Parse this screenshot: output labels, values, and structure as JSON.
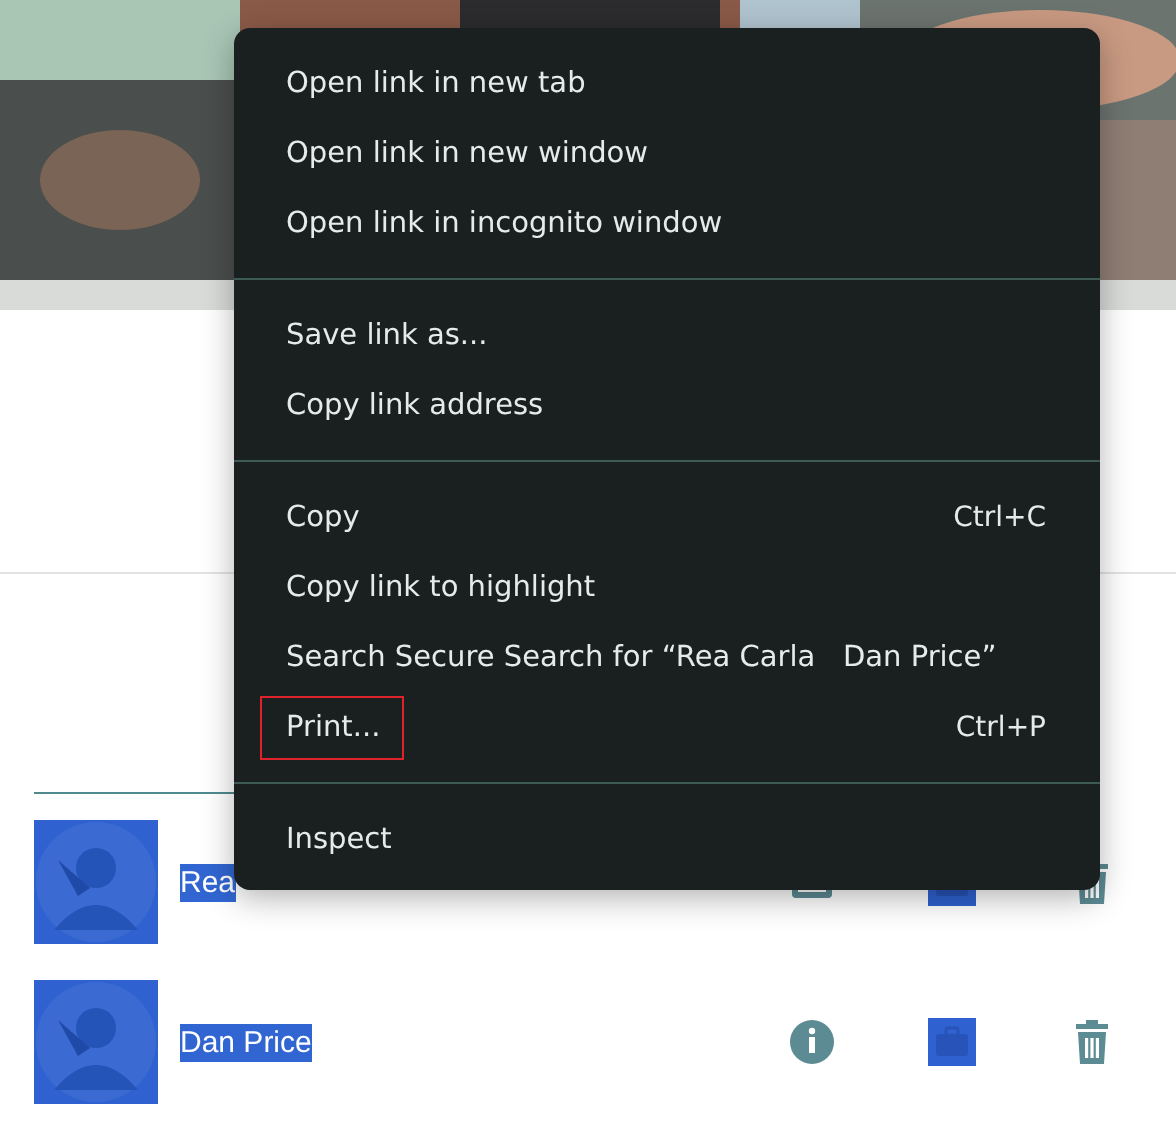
{
  "people": [
    {
      "name": "Rea",
      "selected": true
    },
    {
      "name": "Dan Price",
      "selected": true
    }
  ],
  "context_menu": {
    "sections": [
      [
        {
          "label": "Open link in new tab",
          "focused": false
        },
        {
          "label": "Open link in new window",
          "focused": false
        },
        {
          "label": "Open link in incognito window",
          "focused": false
        }
      ],
      [
        {
          "label": "Save link as...",
          "focused": false
        },
        {
          "label": "Copy link address",
          "focused": false
        }
      ],
      [
        {
          "label": "Copy",
          "shortcut": "Ctrl+C",
          "focused": false
        },
        {
          "label": "Copy link to highlight",
          "focused": false
        },
        {
          "label": "Search Secure Search for “Rea Carla   Dan Price”",
          "focused": false
        },
        {
          "label": "Print...",
          "shortcut": "Ctrl+P",
          "focused": true
        }
      ],
      [
        {
          "label": "Inspect",
          "focused": false
        }
      ]
    ]
  }
}
